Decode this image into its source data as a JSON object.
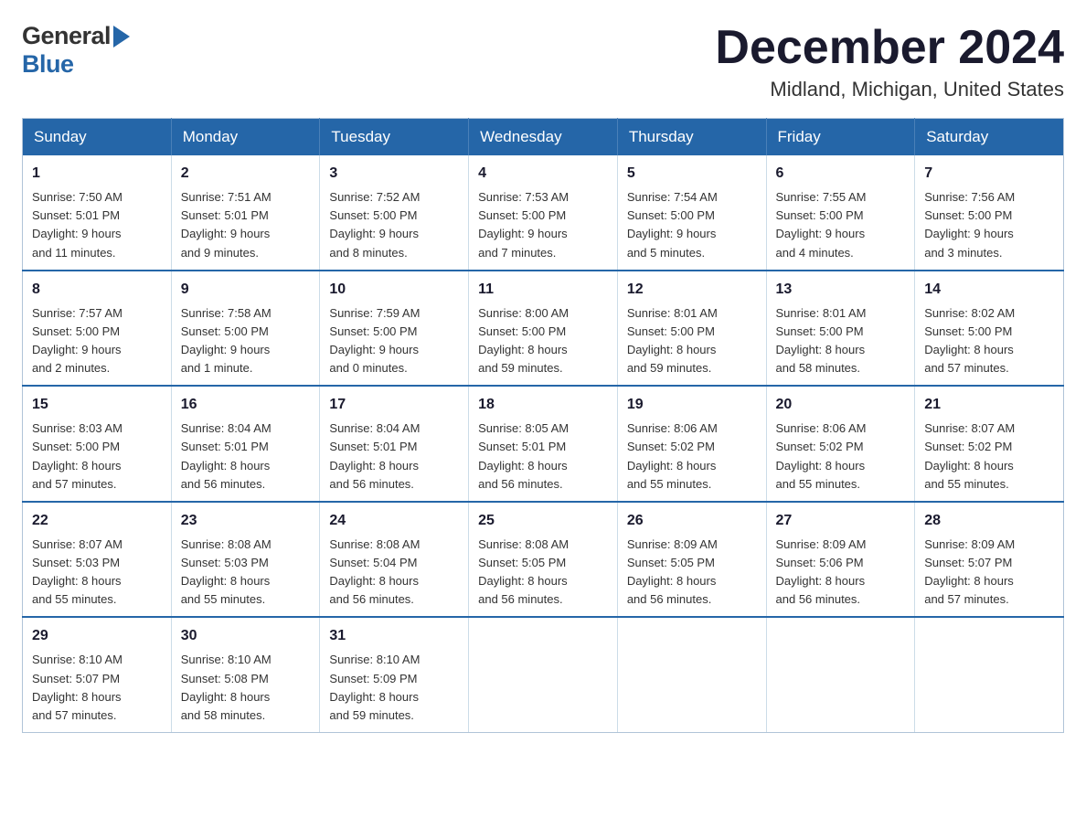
{
  "logo": {
    "general": "General",
    "blue": "Blue",
    "arrow_color": "#2566a8"
  },
  "header": {
    "month_title": "December 2024",
    "location": "Midland, Michigan, United States"
  },
  "weekdays": [
    "Sunday",
    "Monday",
    "Tuesday",
    "Wednesday",
    "Thursday",
    "Friday",
    "Saturday"
  ],
  "weeks": [
    [
      {
        "day": "1",
        "sunrise": "Sunrise: 7:50 AM",
        "sunset": "Sunset: 5:01 PM",
        "daylight": "Daylight: 9 hours",
        "daylight2": "and 11 minutes."
      },
      {
        "day": "2",
        "sunrise": "Sunrise: 7:51 AM",
        "sunset": "Sunset: 5:01 PM",
        "daylight": "Daylight: 9 hours",
        "daylight2": "and 9 minutes."
      },
      {
        "day": "3",
        "sunrise": "Sunrise: 7:52 AM",
        "sunset": "Sunset: 5:00 PM",
        "daylight": "Daylight: 9 hours",
        "daylight2": "and 8 minutes."
      },
      {
        "day": "4",
        "sunrise": "Sunrise: 7:53 AM",
        "sunset": "Sunset: 5:00 PM",
        "daylight": "Daylight: 9 hours",
        "daylight2": "and 7 minutes."
      },
      {
        "day": "5",
        "sunrise": "Sunrise: 7:54 AM",
        "sunset": "Sunset: 5:00 PM",
        "daylight": "Daylight: 9 hours",
        "daylight2": "and 5 minutes."
      },
      {
        "day": "6",
        "sunrise": "Sunrise: 7:55 AM",
        "sunset": "Sunset: 5:00 PM",
        "daylight": "Daylight: 9 hours",
        "daylight2": "and 4 minutes."
      },
      {
        "day": "7",
        "sunrise": "Sunrise: 7:56 AM",
        "sunset": "Sunset: 5:00 PM",
        "daylight": "Daylight: 9 hours",
        "daylight2": "and 3 minutes."
      }
    ],
    [
      {
        "day": "8",
        "sunrise": "Sunrise: 7:57 AM",
        "sunset": "Sunset: 5:00 PM",
        "daylight": "Daylight: 9 hours",
        "daylight2": "and 2 minutes."
      },
      {
        "day": "9",
        "sunrise": "Sunrise: 7:58 AM",
        "sunset": "Sunset: 5:00 PM",
        "daylight": "Daylight: 9 hours",
        "daylight2": "and 1 minute."
      },
      {
        "day": "10",
        "sunrise": "Sunrise: 7:59 AM",
        "sunset": "Sunset: 5:00 PM",
        "daylight": "Daylight: 9 hours",
        "daylight2": "and 0 minutes."
      },
      {
        "day": "11",
        "sunrise": "Sunrise: 8:00 AM",
        "sunset": "Sunset: 5:00 PM",
        "daylight": "Daylight: 8 hours",
        "daylight2": "and 59 minutes."
      },
      {
        "day": "12",
        "sunrise": "Sunrise: 8:01 AM",
        "sunset": "Sunset: 5:00 PM",
        "daylight": "Daylight: 8 hours",
        "daylight2": "and 59 minutes."
      },
      {
        "day": "13",
        "sunrise": "Sunrise: 8:01 AM",
        "sunset": "Sunset: 5:00 PM",
        "daylight": "Daylight: 8 hours",
        "daylight2": "and 58 minutes."
      },
      {
        "day": "14",
        "sunrise": "Sunrise: 8:02 AM",
        "sunset": "Sunset: 5:00 PM",
        "daylight": "Daylight: 8 hours",
        "daylight2": "and 57 minutes."
      }
    ],
    [
      {
        "day": "15",
        "sunrise": "Sunrise: 8:03 AM",
        "sunset": "Sunset: 5:00 PM",
        "daylight": "Daylight: 8 hours",
        "daylight2": "and 57 minutes."
      },
      {
        "day": "16",
        "sunrise": "Sunrise: 8:04 AM",
        "sunset": "Sunset: 5:01 PM",
        "daylight": "Daylight: 8 hours",
        "daylight2": "and 56 minutes."
      },
      {
        "day": "17",
        "sunrise": "Sunrise: 8:04 AM",
        "sunset": "Sunset: 5:01 PM",
        "daylight": "Daylight: 8 hours",
        "daylight2": "and 56 minutes."
      },
      {
        "day": "18",
        "sunrise": "Sunrise: 8:05 AM",
        "sunset": "Sunset: 5:01 PM",
        "daylight": "Daylight: 8 hours",
        "daylight2": "and 56 minutes."
      },
      {
        "day": "19",
        "sunrise": "Sunrise: 8:06 AM",
        "sunset": "Sunset: 5:02 PM",
        "daylight": "Daylight: 8 hours",
        "daylight2": "and 55 minutes."
      },
      {
        "day": "20",
        "sunrise": "Sunrise: 8:06 AM",
        "sunset": "Sunset: 5:02 PM",
        "daylight": "Daylight: 8 hours",
        "daylight2": "and 55 minutes."
      },
      {
        "day": "21",
        "sunrise": "Sunrise: 8:07 AM",
        "sunset": "Sunset: 5:02 PM",
        "daylight": "Daylight: 8 hours",
        "daylight2": "and 55 minutes."
      }
    ],
    [
      {
        "day": "22",
        "sunrise": "Sunrise: 8:07 AM",
        "sunset": "Sunset: 5:03 PM",
        "daylight": "Daylight: 8 hours",
        "daylight2": "and 55 minutes."
      },
      {
        "day": "23",
        "sunrise": "Sunrise: 8:08 AM",
        "sunset": "Sunset: 5:03 PM",
        "daylight": "Daylight: 8 hours",
        "daylight2": "and 55 minutes."
      },
      {
        "day": "24",
        "sunrise": "Sunrise: 8:08 AM",
        "sunset": "Sunset: 5:04 PM",
        "daylight": "Daylight: 8 hours",
        "daylight2": "and 56 minutes."
      },
      {
        "day": "25",
        "sunrise": "Sunrise: 8:08 AM",
        "sunset": "Sunset: 5:05 PM",
        "daylight": "Daylight: 8 hours",
        "daylight2": "and 56 minutes."
      },
      {
        "day": "26",
        "sunrise": "Sunrise: 8:09 AM",
        "sunset": "Sunset: 5:05 PM",
        "daylight": "Daylight: 8 hours",
        "daylight2": "and 56 minutes."
      },
      {
        "day": "27",
        "sunrise": "Sunrise: 8:09 AM",
        "sunset": "Sunset: 5:06 PM",
        "daylight": "Daylight: 8 hours",
        "daylight2": "and 56 minutes."
      },
      {
        "day": "28",
        "sunrise": "Sunrise: 8:09 AM",
        "sunset": "Sunset: 5:07 PM",
        "daylight": "Daylight: 8 hours",
        "daylight2": "and 57 minutes."
      }
    ],
    [
      {
        "day": "29",
        "sunrise": "Sunrise: 8:10 AM",
        "sunset": "Sunset: 5:07 PM",
        "daylight": "Daylight: 8 hours",
        "daylight2": "and 57 minutes."
      },
      {
        "day": "30",
        "sunrise": "Sunrise: 8:10 AM",
        "sunset": "Sunset: 5:08 PM",
        "daylight": "Daylight: 8 hours",
        "daylight2": "and 58 minutes."
      },
      {
        "day": "31",
        "sunrise": "Sunrise: 8:10 AM",
        "sunset": "Sunset: 5:09 PM",
        "daylight": "Daylight: 8 hours",
        "daylight2": "and 59 minutes."
      },
      null,
      null,
      null,
      null
    ]
  ]
}
